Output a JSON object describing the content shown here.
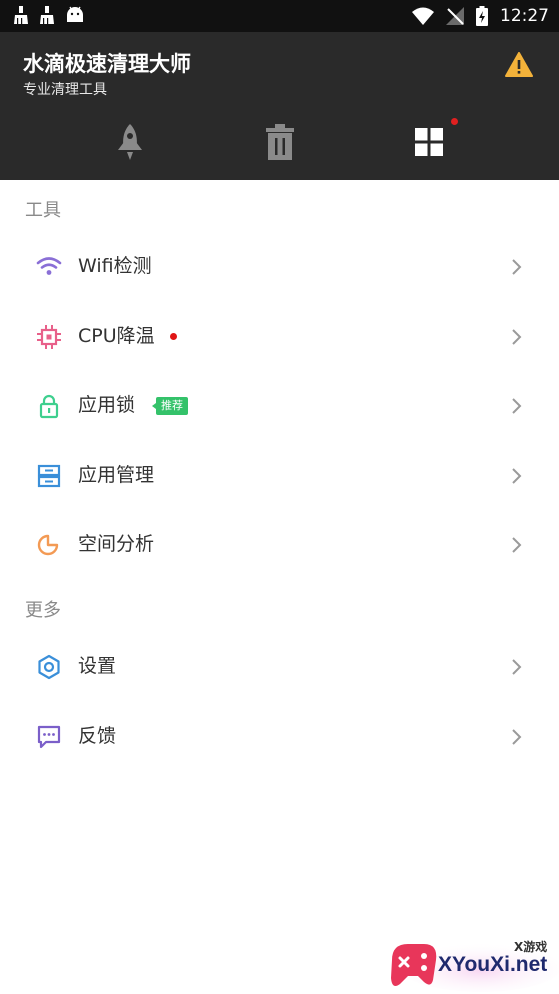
{
  "status_bar": {
    "time": "12:27",
    "left_icons": [
      "cleaner-notification-icon",
      "cleaner-notification-icon",
      "android-icon"
    ],
    "right_icons": [
      "wifi-icon",
      "no-signal-icon",
      "battery-charging-icon"
    ]
  },
  "header": {
    "title": "水滴极速清理大师",
    "subtitle": "专业清理工具",
    "warning_icon": "warning-icon",
    "tabs": [
      {
        "icon": "rocket-icon"
      },
      {
        "icon": "trash-icon"
      },
      {
        "icon": "grid-icon",
        "has_dot": true
      }
    ]
  },
  "sections": {
    "tools": {
      "title": "工具",
      "items": [
        {
          "label": "Wifi检测",
          "icon": "wifi-icon",
          "color": "#8a6fd6"
        },
        {
          "label": "CPU降温",
          "icon": "cpu-icon",
          "color": "#e8608a",
          "has_dot": true
        },
        {
          "label": "应用锁",
          "icon": "lock-icon",
          "color": "#3ecf8e",
          "badge": "推荐"
        },
        {
          "label": "应用管理",
          "icon": "app-manage-icon",
          "color": "#3a8fd9"
        },
        {
          "label": "空间分析",
          "icon": "pie-chart-icon",
          "color": "#f39a54"
        }
      ]
    },
    "more": {
      "title": "更多",
      "items": [
        {
          "label": "设置",
          "icon": "gear-icon",
          "color": "#3a8fd9"
        },
        {
          "label": "反馈",
          "icon": "feedback-icon",
          "color": "#7b5fc9"
        }
      ]
    }
  },
  "watermark": {
    "cn_text": "X游戏",
    "en_text": "XYouXi.net"
  },
  "colors": {
    "header_bg": "#2a2a2a",
    "status_bar_bg": "#111111",
    "badge_green": "#34c26a",
    "dot_red": "#e01515"
  }
}
